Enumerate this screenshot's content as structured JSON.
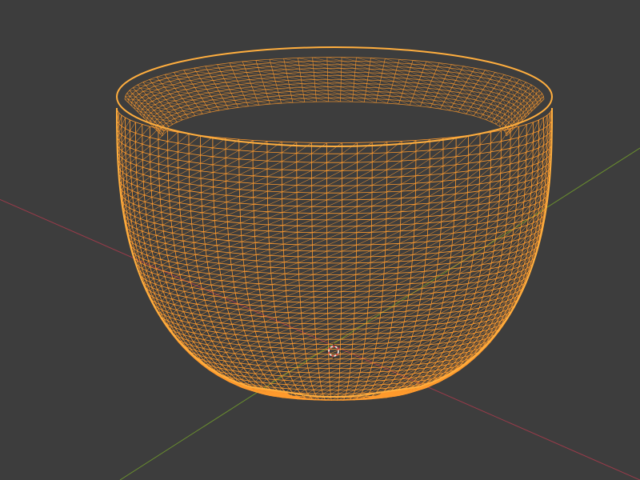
{
  "viewport": {
    "view_mode": "wireframe",
    "background_color": "#3d3d3d",
    "object_selected": true
  },
  "colors": {
    "x_axis": "#9a3b4a",
    "y_axis": "#6a8f2e",
    "wire_selected": "#ff9b2e",
    "wire_outline": "#ffae3e",
    "origin_marker": "#f0d8b8",
    "cursor_red": "#e24a4a",
    "cursor_white": "#f2f2f2"
  },
  "scene": {
    "object": "bowl-mesh",
    "axes": [
      "x-axis",
      "y-axis"
    ],
    "cursor": "3d-cursor-icon"
  }
}
